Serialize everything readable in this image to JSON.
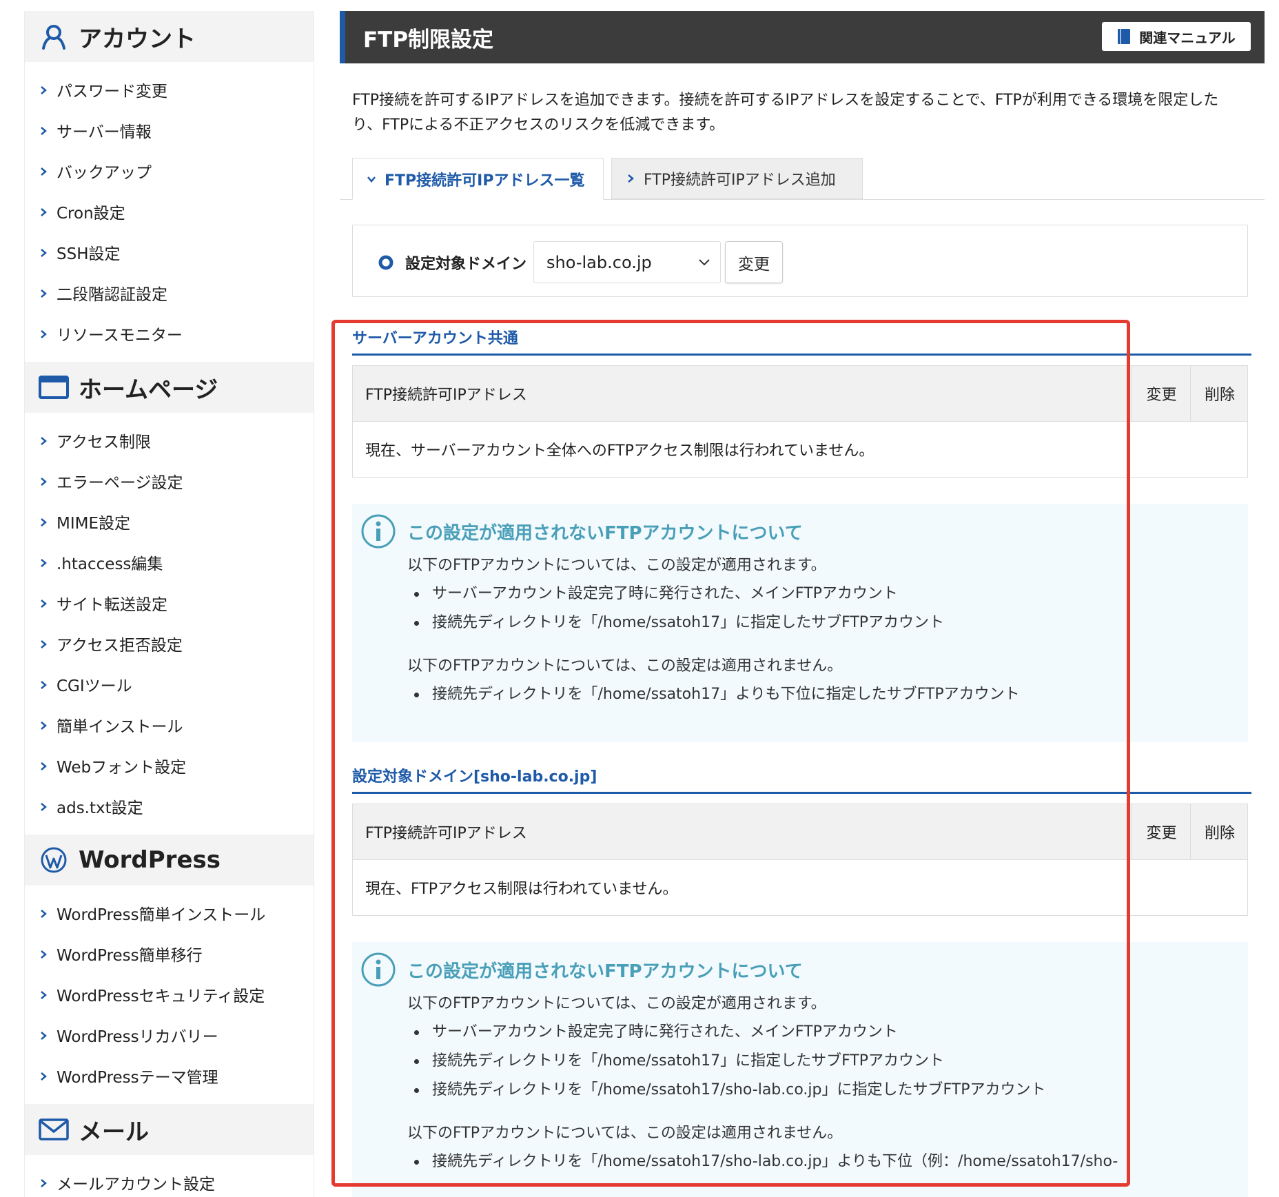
{
  "sidebar": {
    "sections": [
      {
        "title": "アカウント",
        "icon": "user-icon",
        "items": [
          "パスワード変更",
          "サーバー情報",
          "バックアップ",
          "Cron設定",
          "SSH設定",
          "二段階認証設定",
          "リソースモニター"
        ]
      },
      {
        "title": "ホームページ",
        "icon": "browser-window-icon",
        "items": [
          "アクセス制限",
          "エラーページ設定",
          "MIME設定",
          ".htaccess編集",
          "サイト転送設定",
          "アクセス拒否設定",
          "CGIツール",
          "簡単インストール",
          "Webフォント設定",
          "ads.txt設定"
        ]
      },
      {
        "title": "WordPress",
        "icon": "wordpress-icon",
        "items": [
          "WordPress簡単インストール",
          "WordPress簡単移行",
          "WordPressセキュリティ設定",
          "WordPressリカバリー",
          "WordPressテーマ管理"
        ]
      },
      {
        "title": "メール",
        "icon": "mail-icon",
        "items": [
          "メールアカウント設定"
        ]
      }
    ]
  },
  "header": {
    "title": "FTP制限設定",
    "manual_label": "関連マニュアル"
  },
  "description": "FTP接続を許可するIPアドレスを追加できます。接続を許可するIPアドレスを設定することで、FTPが利用できる環境を限定したり、FTPによる不正アクセスのリスクを低減できます。",
  "tabs": [
    {
      "label": "FTP接続許可IPアドレス一覧",
      "active": true
    },
    {
      "label": "FTP接続許可IPアドレス追加",
      "active": false
    }
  ],
  "domain": {
    "label": "設定対象ドメイン",
    "selected": "sho-lab.co.jp",
    "change_label": "変更"
  },
  "sections": [
    {
      "heading": "サーバーアカウント共通",
      "table": {
        "col_ip": "FTP接続許可IPアドレス",
        "col_change": "変更",
        "col_delete": "削除",
        "empty_message": "現在、サーバーアカウント全体へのFTPアクセス制限は行われていません。"
      },
      "info": {
        "title": "この設定が適用されないFTPアカウントについて",
        "applied_intro": "以下のFTPアカウントについては、この設定が適用されます。",
        "applied_items": [
          "サーバーアカウント設定完了時に発行された、メインFTPアカウント",
          "接続先ディレクトリを「/home/ssatoh17」に指定したサブFTPアカウント"
        ],
        "not_applied_intro": "以下のFTPアカウントについては、この設定は適用されません。",
        "not_applied_items": [
          "接続先ディレクトリを「/home/ssatoh17」よりも下位に指定したサブFTPアカウント"
        ]
      }
    },
    {
      "heading": "設定対象ドメイン[sho-lab.co.jp]",
      "table": {
        "col_ip": "FTP接続許可IPアドレス",
        "col_change": "変更",
        "col_delete": "削除",
        "empty_message": "現在、FTPアクセス制限は行われていません。"
      },
      "info": {
        "title": "この設定が適用されないFTPアカウントについて",
        "applied_intro": "以下のFTPアカウントについては、この設定が適用されます。",
        "applied_items": [
          "サーバーアカウント設定完了時に発行された、メインFTPアカウント",
          "接続先ディレクトリを「/home/ssatoh17」に指定したサブFTPアカウント",
          "接続先ディレクトリを「/home/ssatoh17/sho-lab.co.jp」に指定したサブFTPアカウント"
        ],
        "not_applied_intro": "以下のFTPアカウントについては、この設定は適用されません。",
        "not_applied_items": [
          "接続先ディレクトリを「/home/ssatoh17/sho-lab.co.jp」よりも下位（例：/home/ssatoh17/sho-"
        ]
      }
    }
  ],
  "colors": {
    "accent": "#1e5aa8",
    "header_bg": "#3c3c3c",
    "info_title": "#4a9fb8",
    "info_bg": "#f2fafd",
    "highlight": "#e53a2f"
  }
}
